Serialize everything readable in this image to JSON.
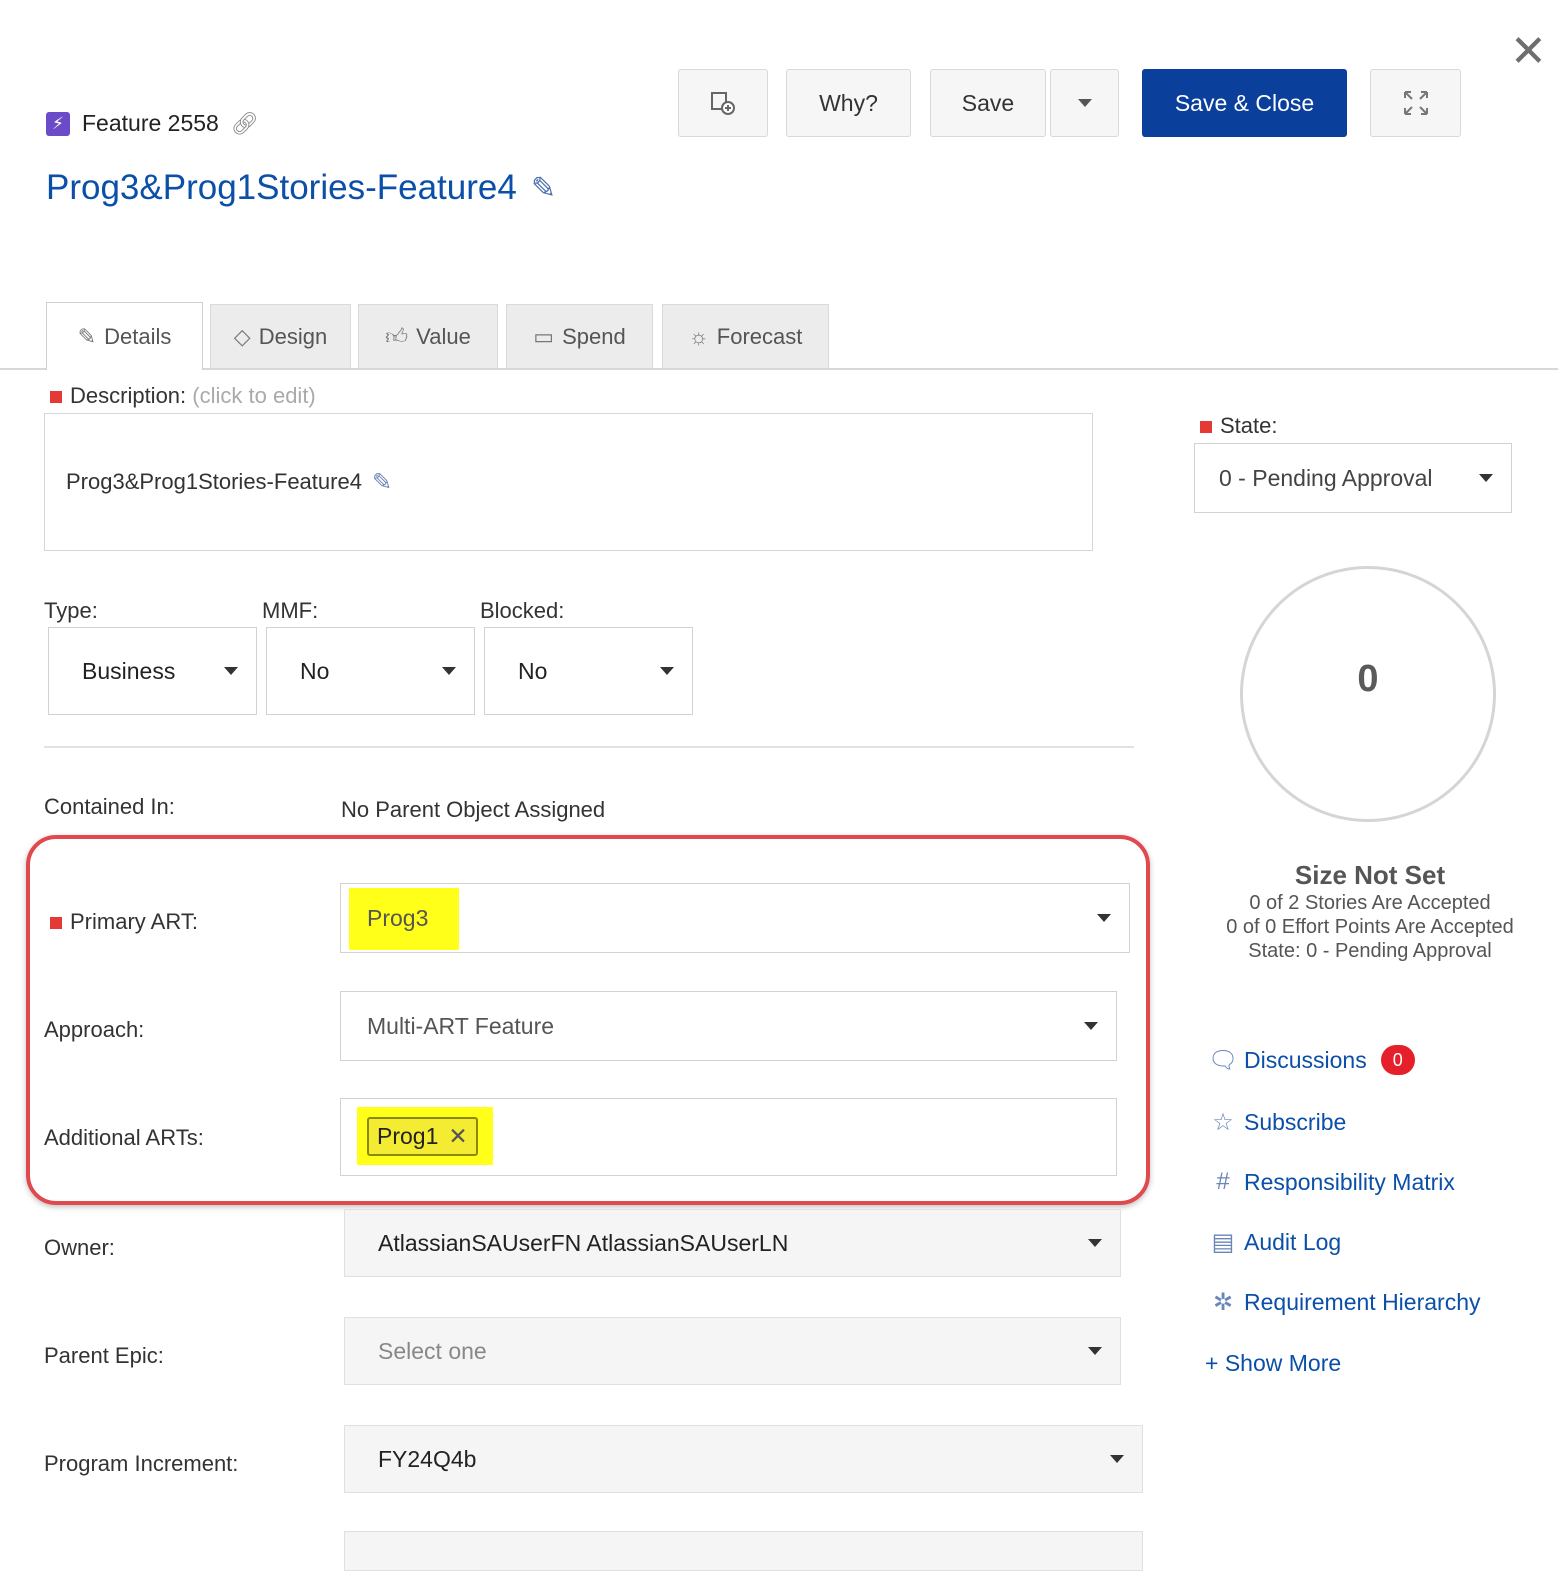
{
  "header": {
    "feature_id": "Feature 2558",
    "title": "Prog3&Prog1Stories-Feature4",
    "buttons": {
      "why": "Why?",
      "save": "Save",
      "save_close": "Save & Close"
    },
    "close_glyph": "✕"
  },
  "tabs": [
    {
      "label": "Details",
      "icon": "pencil-icon"
    },
    {
      "label": "Design",
      "icon": "diamond-icon"
    },
    {
      "label": "Value",
      "icon": "thumbs-up-icon"
    },
    {
      "label": "Spend",
      "icon": "money-icon"
    },
    {
      "label": "Forecast",
      "icon": "sun-icon"
    }
  ],
  "description": {
    "label": "Description:",
    "hint": "(click to edit)",
    "value": "Prog3&Prog1Stories-Feature4"
  },
  "fields": {
    "type": {
      "label": "Type:",
      "value": "Business"
    },
    "mmf": {
      "label": "MMF:",
      "value": "No"
    },
    "blocked": {
      "label": "Blocked:",
      "value": "No"
    },
    "contained_in": {
      "label": "Contained In:",
      "value": "No Parent Object Assigned"
    },
    "primary_art": {
      "label": "Primary ART:",
      "value": "Prog3"
    },
    "approach": {
      "label": "Approach:",
      "value": "Multi-ART Feature"
    },
    "additional_arts": {
      "label": "Additional ARTs:",
      "chip": "Prog1"
    },
    "owner": {
      "label": "Owner:",
      "value": "AtlassianSAUserFN AtlassianSAUserLN"
    },
    "parent_epic": {
      "label": "Parent Epic:",
      "placeholder": "Select one"
    },
    "program_increment": {
      "label": "Program Increment:",
      "value": "FY24Q4b"
    }
  },
  "state": {
    "label": "State:",
    "value": "0 - Pending Approval"
  },
  "progress": {
    "value": "0",
    "title": "Size Not Set",
    "lines": [
      "0 of 2 Stories Are Accepted",
      "0 of 0 Effort Points Are Accepted",
      "State: 0 - Pending Approval"
    ]
  },
  "side_links": {
    "discussions": "Discussions",
    "discussions_count": "0",
    "subscribe": "Subscribe",
    "responsibility_matrix": "Responsibility Matrix",
    "audit_log": "Audit Log",
    "requirement_hierarchy": "Requirement Hierarchy",
    "show_more": "+ Show More"
  },
  "colors": {
    "brand_blue": "#0a3f9c",
    "link_blue": "#0b4fa8",
    "required_red": "#e53935",
    "highlight_yellow": "#ffff1a",
    "callout_red": "#e04a4f"
  }
}
